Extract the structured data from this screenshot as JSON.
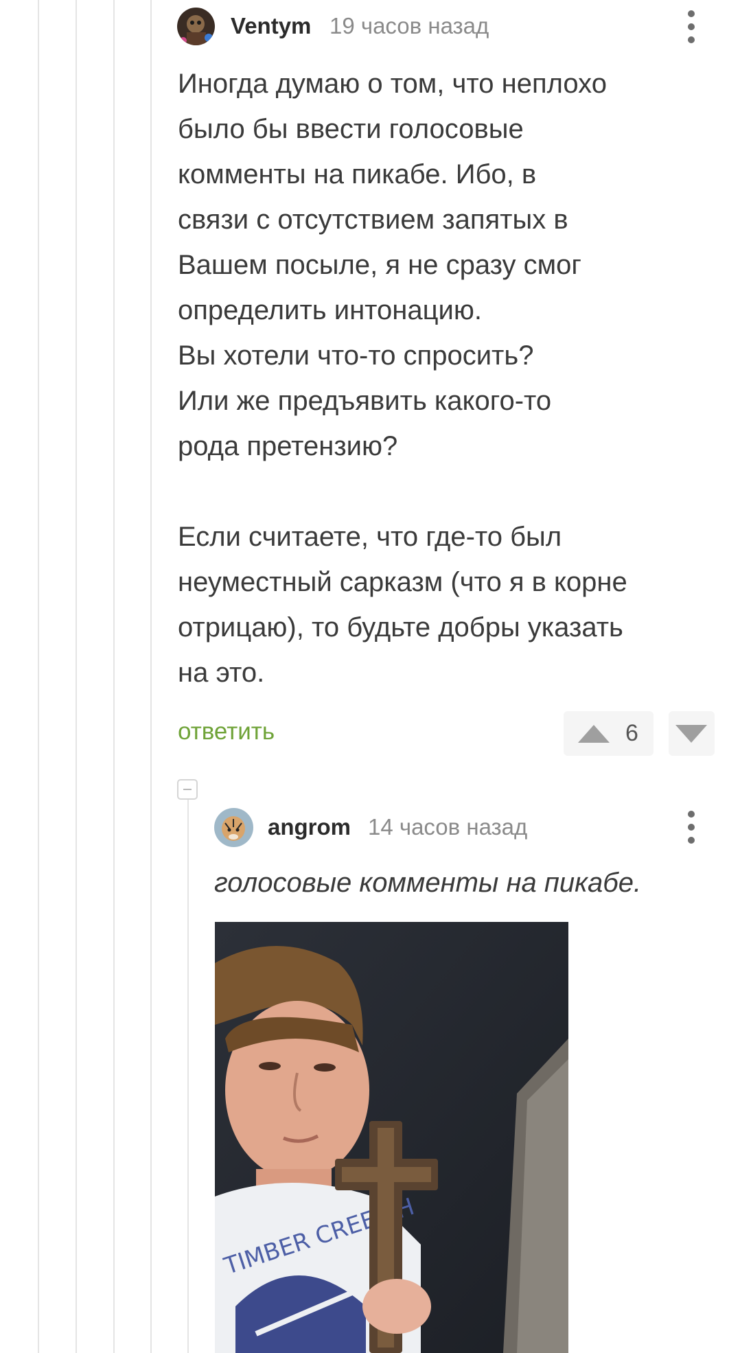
{
  "comment1": {
    "author": "Ventym",
    "time": "19 часов назад",
    "text": "Иногда думаю о том, что неплохо\nбыло бы ввести голосовые\nкомменты на пикабе. Ибо, в\nсвязи с отсутствием запятых в\nВашем посыле, я не сразу смог\nопределить интонацию.\nВы хотели что-то спросить?\nИли же предъявить какого-то\nрода претензию?\n\nЕсли считаете, что где-то был\nнеуместный сарказм (что я в корне\nотрицаю), то будьте добры указать\nна это.",
    "reply_label": "ответить",
    "rating": "6"
  },
  "comment2": {
    "author": "angrom",
    "time": "14 часов назад",
    "quote": "голосовые комменты на пикабе.",
    "image_text": "TIMBER CREEK H"
  },
  "icons": {
    "menu": "kebab-menu-icon",
    "upvote": "upvote-arrow-icon",
    "downvote": "downvote-arrow-icon",
    "collapse": "collapse-thread-icon"
  },
  "colors": {
    "reply_link": "#6fa338",
    "thread_line": "#e4e4e4",
    "muted": "#8a8a8a"
  }
}
